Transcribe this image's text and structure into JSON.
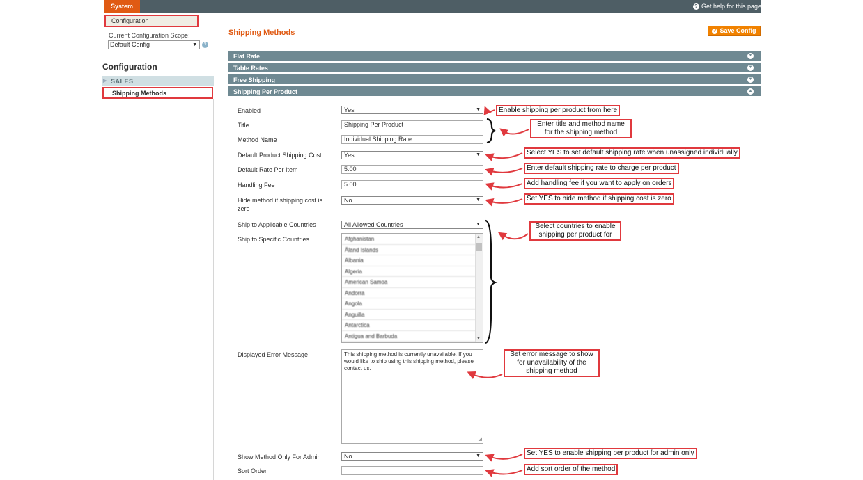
{
  "topbar": {
    "system_tab": "System",
    "help": "Get help for this page"
  },
  "submenu": {
    "configuration": "Configuration"
  },
  "sidebar": {
    "scope_label": "Current Configuration Scope:",
    "scope_value": "Default Config",
    "heading": "Configuration",
    "sales": "SALES",
    "shipping_methods": "Shipping Methods"
  },
  "main": {
    "title": "Shipping Methods",
    "save_label": "Save Config",
    "sections": [
      "Flat Rate",
      "Table Rates",
      "Free Shipping",
      "Shipping Per Product"
    ]
  },
  "form": {
    "enabled": {
      "label": "Enabled",
      "value": "Yes"
    },
    "title": {
      "label": "Title",
      "value": "Shipping Per Product"
    },
    "method_name": {
      "label": "Method Name",
      "value": "Individual Shipping Rate"
    },
    "default_cost": {
      "label": "Default Product Shipping Cost",
      "value": "Yes"
    },
    "default_rate": {
      "label": "Default Rate Per Item",
      "value": "5.00"
    },
    "handling_fee": {
      "label": "Handling Fee",
      "value": "5.00"
    },
    "hide_method": {
      "label": "Hide method if shipping cost is zero",
      "value": "No"
    },
    "applicable_countries": {
      "label": "Ship to Applicable Countries",
      "value": "All Allowed Countries"
    },
    "specific_countries": {
      "label": "Ship to Specific Countries",
      "options": [
        "Afghanistan",
        "Åland Islands",
        "Albania",
        "Algeria",
        "American Samoa",
        "Andorra",
        "Angola",
        "Anguilla",
        "Antarctica",
        "Antigua and Barbuda"
      ]
    },
    "error_message": {
      "label": "Displayed Error Message",
      "value": "This shipping method is currently unavailable. If you would like to ship using this shipping method, please contact us."
    },
    "admin_only": {
      "label": "Show Method Only For Admin",
      "value": "No"
    },
    "sort_order": {
      "label": "Sort Order",
      "value": ""
    }
  },
  "callouts": {
    "enabled": "Enable shipping per product from here",
    "title": "Enter title and method name for the shipping method",
    "default_cost": "Select YES to set default shipping rate when unassigned individually",
    "default_rate": "Enter default shipping rate to charge per product",
    "handling": "Add handling fee if you want to apply on orders",
    "hide": "Set YES to hide method if shipping cost is zero",
    "countries": "Select countries to enable shipping per product for",
    "error": "Set error message to show for unavailability of the shipping method",
    "admin": "Set YES to enable shipping per product for admin only",
    "sort": "Add sort order of the method"
  },
  "colors": {
    "accent": "#e05a13",
    "callout_border": "#e0393e",
    "section_bg": "#6f8992"
  }
}
